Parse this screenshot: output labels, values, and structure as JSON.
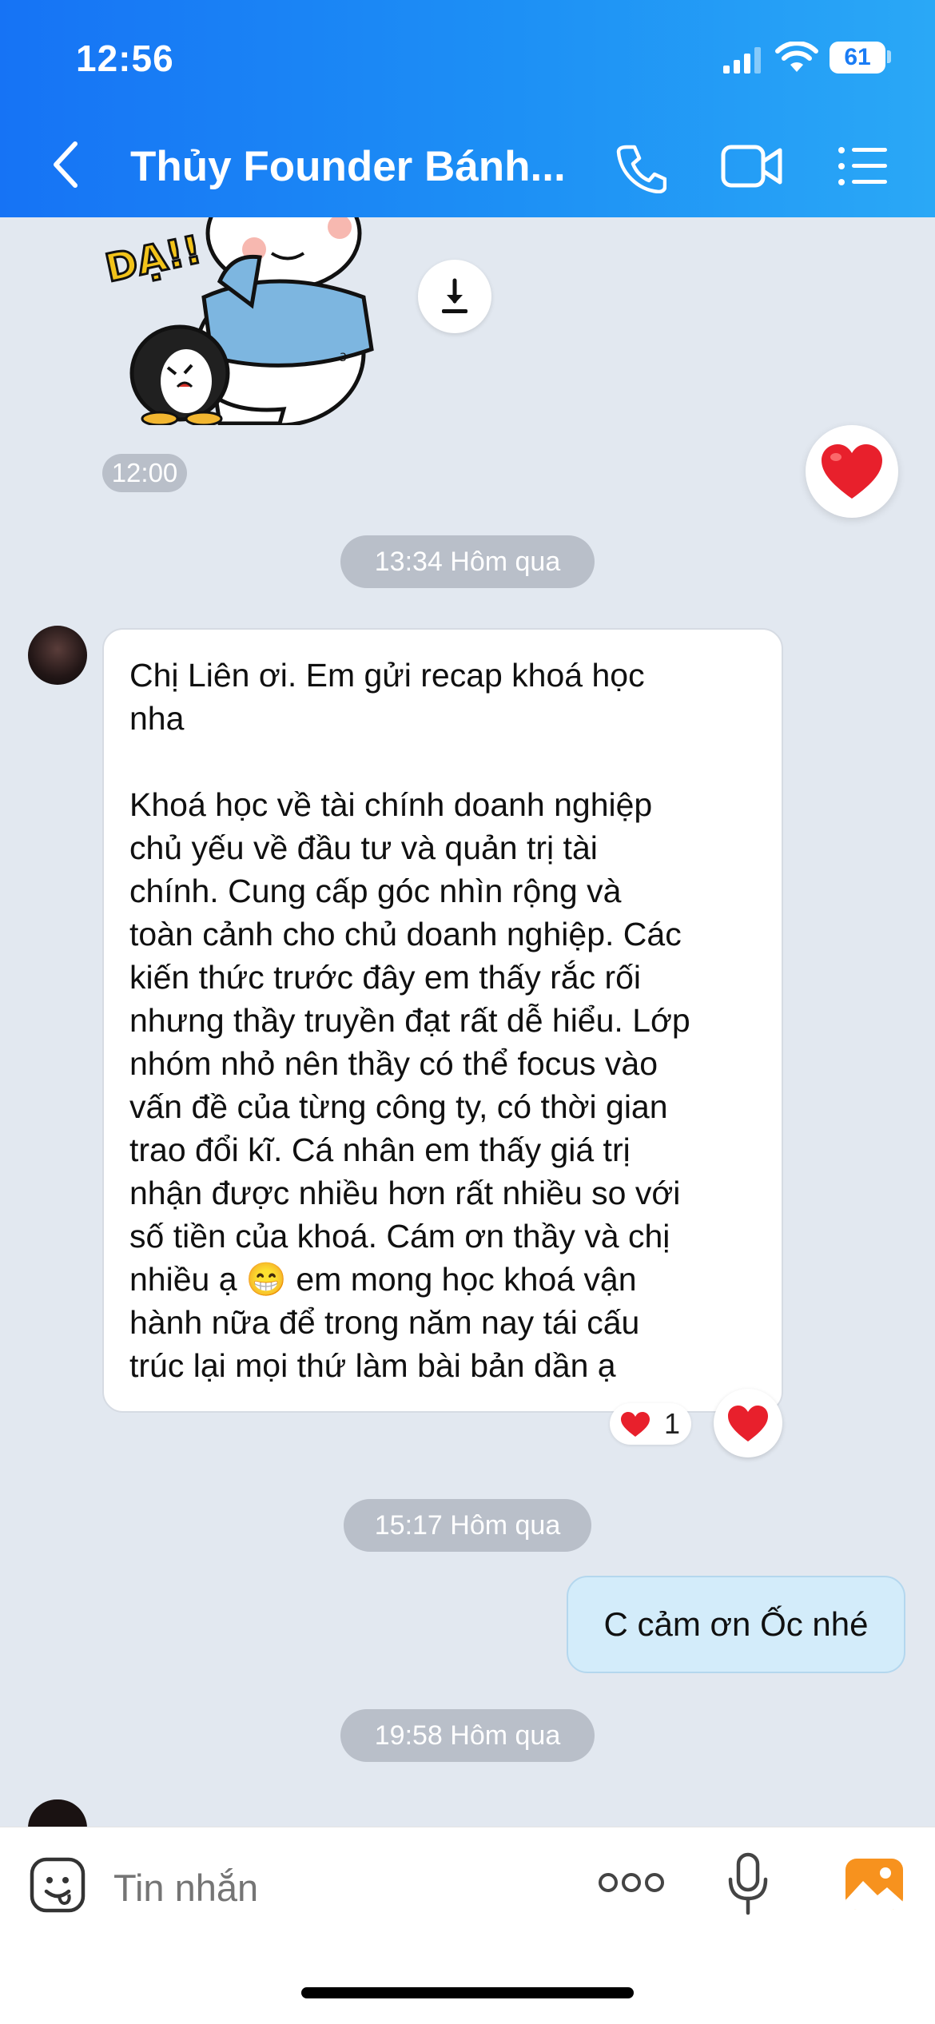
{
  "status_bar": {
    "time": "12:56",
    "battery": "61"
  },
  "header": {
    "title": "Thủy Founder Bánh...",
    "icons": [
      "back-chevron-icon",
      "phone-icon",
      "video-call-icon",
      "menu-list-icon"
    ]
  },
  "messages": {
    "sticker": {
      "text": "DẠ!!",
      "time": "12:00"
    },
    "date_separator_1": "13:34 Hôm qua",
    "incoming_text": "Chị Liên ơi. Em gửi recap khoá học\nnha\n\nKhoá học về tài chính doanh nghiệp\nchủ yếu về đầu tư và quản trị tài\nchính. Cung cấp góc nhìn rộng và\ntoàn cảnh cho chủ doanh nghiệp. Các\nkiến thức trước đây em thấy rắc rối\nnhưng thầy truyền đạt rất dễ hiểu. Lớp\nnhóm nhỏ nên thầy có thể focus vào\nvấn đề của từng công ty, có thời gian\ntrao đổi kĩ. Cá nhân em thấy giá trị\nnhận được nhiều hơn rất nhiều so với\nsố tiền của khoá. Cám ơn thầy và chị\nnhiều ạ 😁 em mong học khoá vận\nhành nữa để trong năm nay tái cấu\ntrúc lại mọi thứ làm bài bản dần ạ",
    "reaction_count": "1",
    "date_separator_2": "15:17 Hôm qua",
    "outgoing_text": "C cảm ơn Ốc nhé",
    "date_separator_3": "19:58 Hôm qua"
  },
  "input": {
    "placeholder": "Tin nhắn"
  },
  "colors": {
    "header_start": "#1673f5",
    "header_end": "#2aa8f6",
    "chat_bg": "#e2e8f0",
    "outgoing_bubble": "#d3ecfa",
    "heart": "#e8202c",
    "image_icon": "#f7921e"
  }
}
